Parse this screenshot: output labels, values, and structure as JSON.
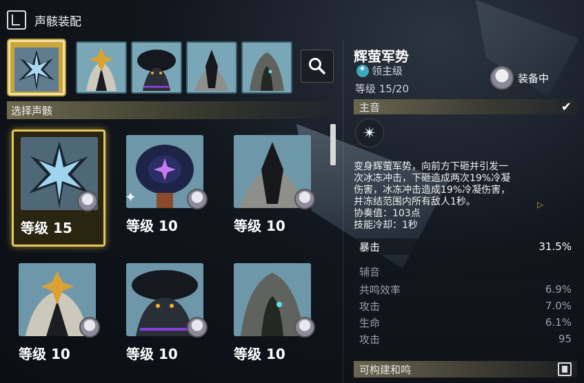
{
  "header": {
    "title": "声骸装配"
  },
  "carousel": {
    "items": [
      "active",
      "crest",
      "flower",
      "shard",
      "hood"
    ]
  },
  "section": {
    "select_label": "选择声骸"
  },
  "grid": {
    "cards": [
      {
        "level": "等级 15",
        "selected": true
      },
      {
        "level": "等级 10",
        "starred": true
      },
      {
        "level": "等级 10"
      },
      {
        "level": "等级 10"
      },
      {
        "level": "等级 10"
      },
      {
        "level": "等级 10"
      }
    ]
  },
  "detail": {
    "name": "辉萤军势",
    "rarity": "领主级",
    "level": "等级 15/20",
    "equip_status": "装备中",
    "main_label": "主音",
    "description": [
      "变身辉萤军势，向前方下砸并引发一",
      "次冰冻冲击，下砸造成两次19%冷凝",
      "伤害，冰冻冲击造成19%冷凝伤害，",
      "并冻结范围内所有敌人1秒。",
      "协奏值：103点",
      "技能冷却：1秒"
    ],
    "main_stat": {
      "name": "暴击",
      "value": "31.5%"
    },
    "sub_label": "辅音",
    "sub_stats": [
      {
        "name": "共鸣效率",
        "value": "6.9%"
      },
      {
        "name": "攻击",
        "value": "7.0%"
      },
      {
        "name": "生命",
        "value": "6.1%"
      },
      {
        "name": "攻击",
        "value": "95"
      }
    ],
    "set_label": "可构建和鸣"
  }
}
